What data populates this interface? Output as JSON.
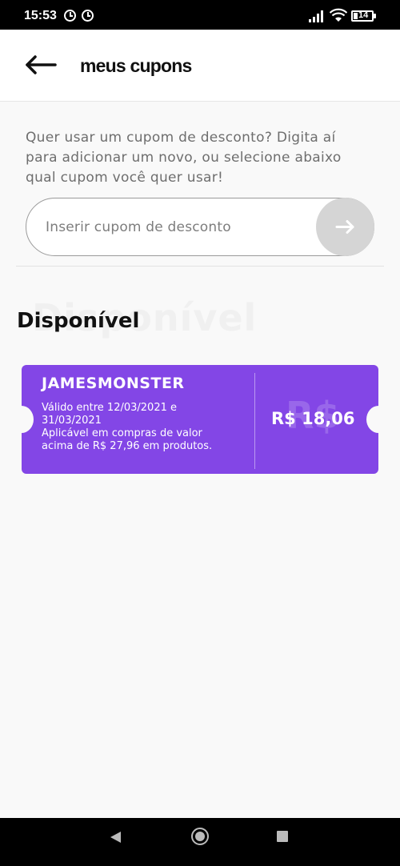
{
  "status_bar": {
    "time": "15:53",
    "battery": "14"
  },
  "header": {
    "title": "meus cupons",
    "back_icon": "arrow-left-icon"
  },
  "intro": {
    "line1": "Quer usar um cupom de desconto? Digita aí",
    "line2": "para adicionar um novo, ou selecione abaixo",
    "line3": "qual cupom você quer usar!"
  },
  "coupon_input": {
    "placeholder": "Inserir cupom de desconto",
    "value": "",
    "submit_icon": "arrow-right-icon"
  },
  "section": {
    "title": "Disponível",
    "title_background": "Disponível"
  },
  "coupons": [
    {
      "code": "JAMESMONSTER",
      "validity_line1": "Válido entre 12/03/2021 e",
      "validity_line2": "31/03/2021",
      "condition_line1": "Aplicável em compras de valor",
      "condition_line2": "acima de R$ 27,96 em produtos.",
      "value": "R$ 18,06",
      "watermark": "R$",
      "color": "#8346e6"
    }
  ],
  "colors": {
    "accent": "#8346e6",
    "background": "#f9f9f9",
    "submit_button": "#d5d5d5"
  }
}
